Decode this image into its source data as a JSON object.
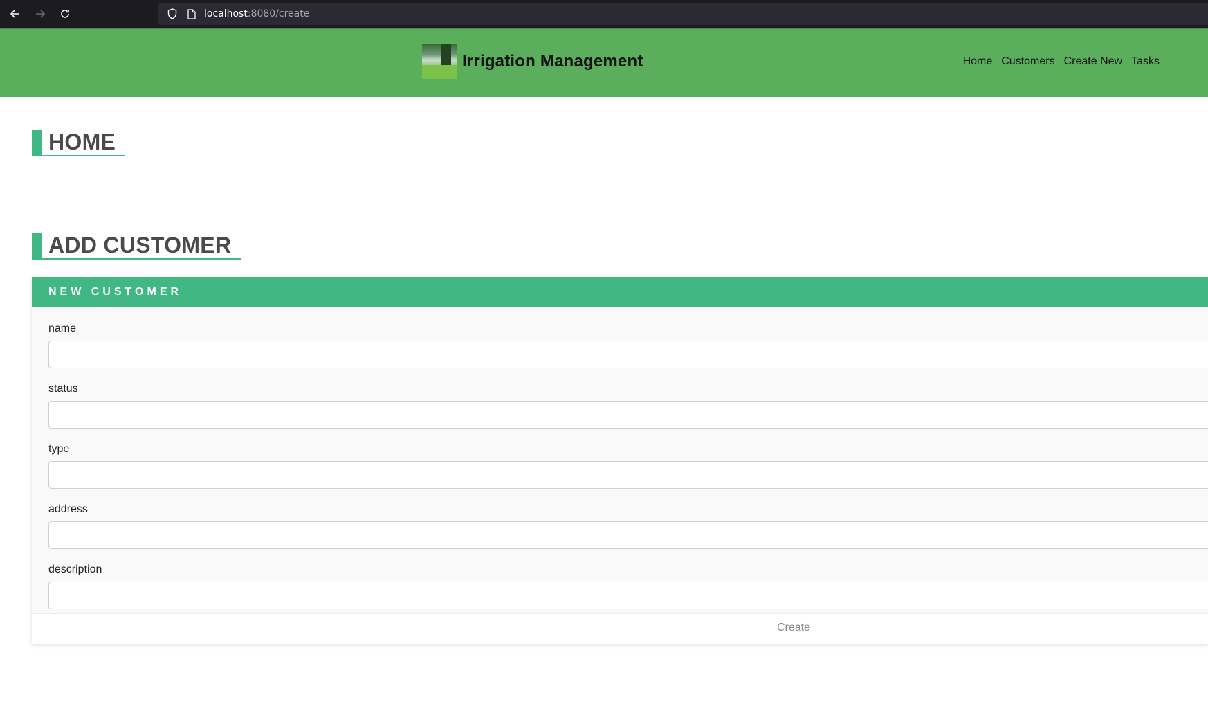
{
  "browser": {
    "url_host": "localhost",
    "url_path": ":8080/create",
    "back_icon": "arrow-left-icon",
    "forward_icon": "arrow-right-icon",
    "reload_icon": "reload-icon"
  },
  "header": {
    "title": "Irrigation Management",
    "nav": [
      "Home",
      "Customers",
      "Create New",
      "Tasks"
    ],
    "background_color": "#5aae5c"
  },
  "sections": {
    "home_title": "HOME",
    "add_title": "ADD CUSTOMER"
  },
  "form": {
    "header": "NEW CUSTOMER",
    "fields": [
      {
        "label": "name",
        "value": ""
      },
      {
        "label": "status",
        "value": ""
      },
      {
        "label": "type",
        "value": ""
      },
      {
        "label": "address",
        "value": ""
      },
      {
        "label": "description",
        "value": ""
      }
    ],
    "submit_label": "Create"
  },
  "colors": {
    "accent": "#41b883",
    "title_text": "#4a4a4a"
  }
}
